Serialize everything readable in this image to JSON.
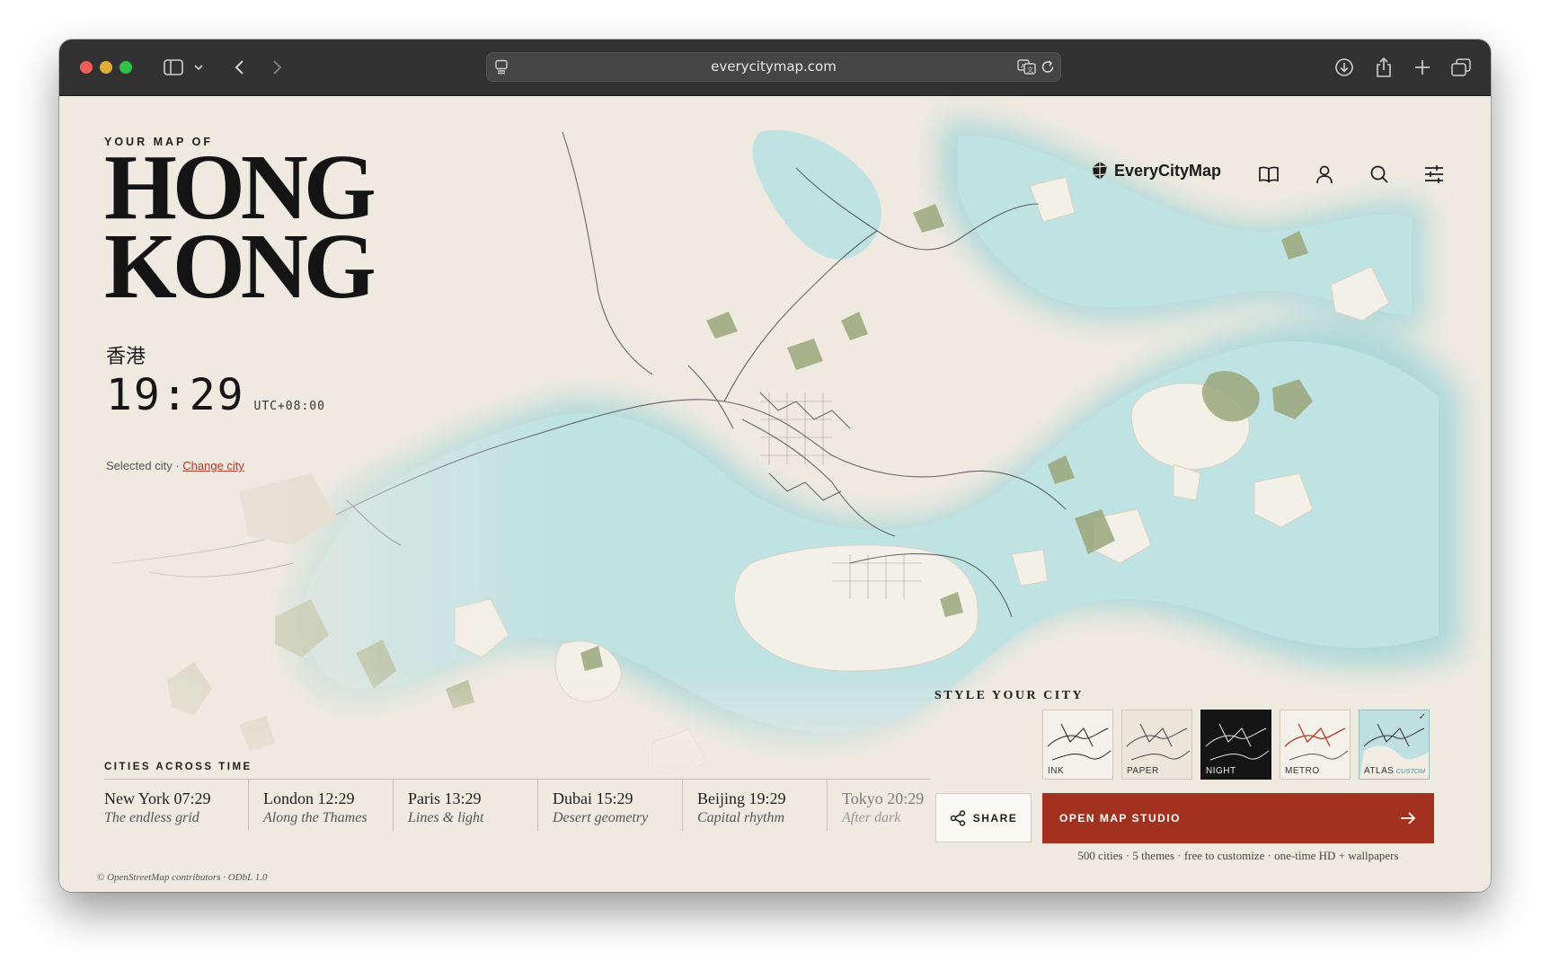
{
  "browser": {
    "url": "everycitymap.com",
    "icons": [
      "sidebar-toggle-icon",
      "chevron-down-icon",
      "back-icon",
      "forward-icon",
      "reader-icon",
      "translate-icon",
      "reload-icon",
      "download-icon",
      "share-icon",
      "new-tab-icon",
      "tabs-overview-icon"
    ]
  },
  "hero": {
    "eyebrow": "YOUR MAP OF",
    "city_line1": "HONG",
    "city_line2": "KONG",
    "city_native": "香港",
    "time": "19:29",
    "timezone": "UTC+08:00",
    "selected_label": "Selected city ·",
    "change_city": "Change city"
  },
  "nav": {
    "brand": "EveryCityMap",
    "icons": [
      "book-icon",
      "user-icon",
      "search-icon",
      "sliders-icon"
    ]
  },
  "styles": {
    "heading": "STYLE YOUR CITY",
    "themes": [
      {
        "label": "INK"
      },
      {
        "label": "PAPER"
      },
      {
        "label": "NIGHT"
      },
      {
        "label": "METRO"
      },
      {
        "label": "ATLAS",
        "sub": "CUSTOM",
        "selected": true
      }
    ]
  },
  "actions": {
    "share": "SHARE",
    "studio": "OPEN MAP STUDIO",
    "note": "500 cities · 5 themes · free to customize · one-time HD + wallpapers"
  },
  "cities_across_time": {
    "heading": "CITIES ACROSS TIME",
    "items": [
      {
        "city": "New York 07:29",
        "tagline": "The endless grid"
      },
      {
        "city": "London 12:29",
        "tagline": "Along the Thames"
      },
      {
        "city": "Paris 13:29",
        "tagline": "Lines & light"
      },
      {
        "city": "Dubai 15:29",
        "tagline": "Desert geometry"
      },
      {
        "city": "Beijing 19:29",
        "tagline": "Capital rhythm"
      },
      {
        "city": "Tokyo 20:29",
        "tagline": "After dark"
      }
    ]
  },
  "attribution": "© OpenStreetMap contributors · ODbL 1.0",
  "colors": {
    "accent": "#a2321f",
    "water": "#bfe2e3",
    "land": "#efeae0",
    "park": "#9aa77a",
    "link": "#b2382a"
  }
}
